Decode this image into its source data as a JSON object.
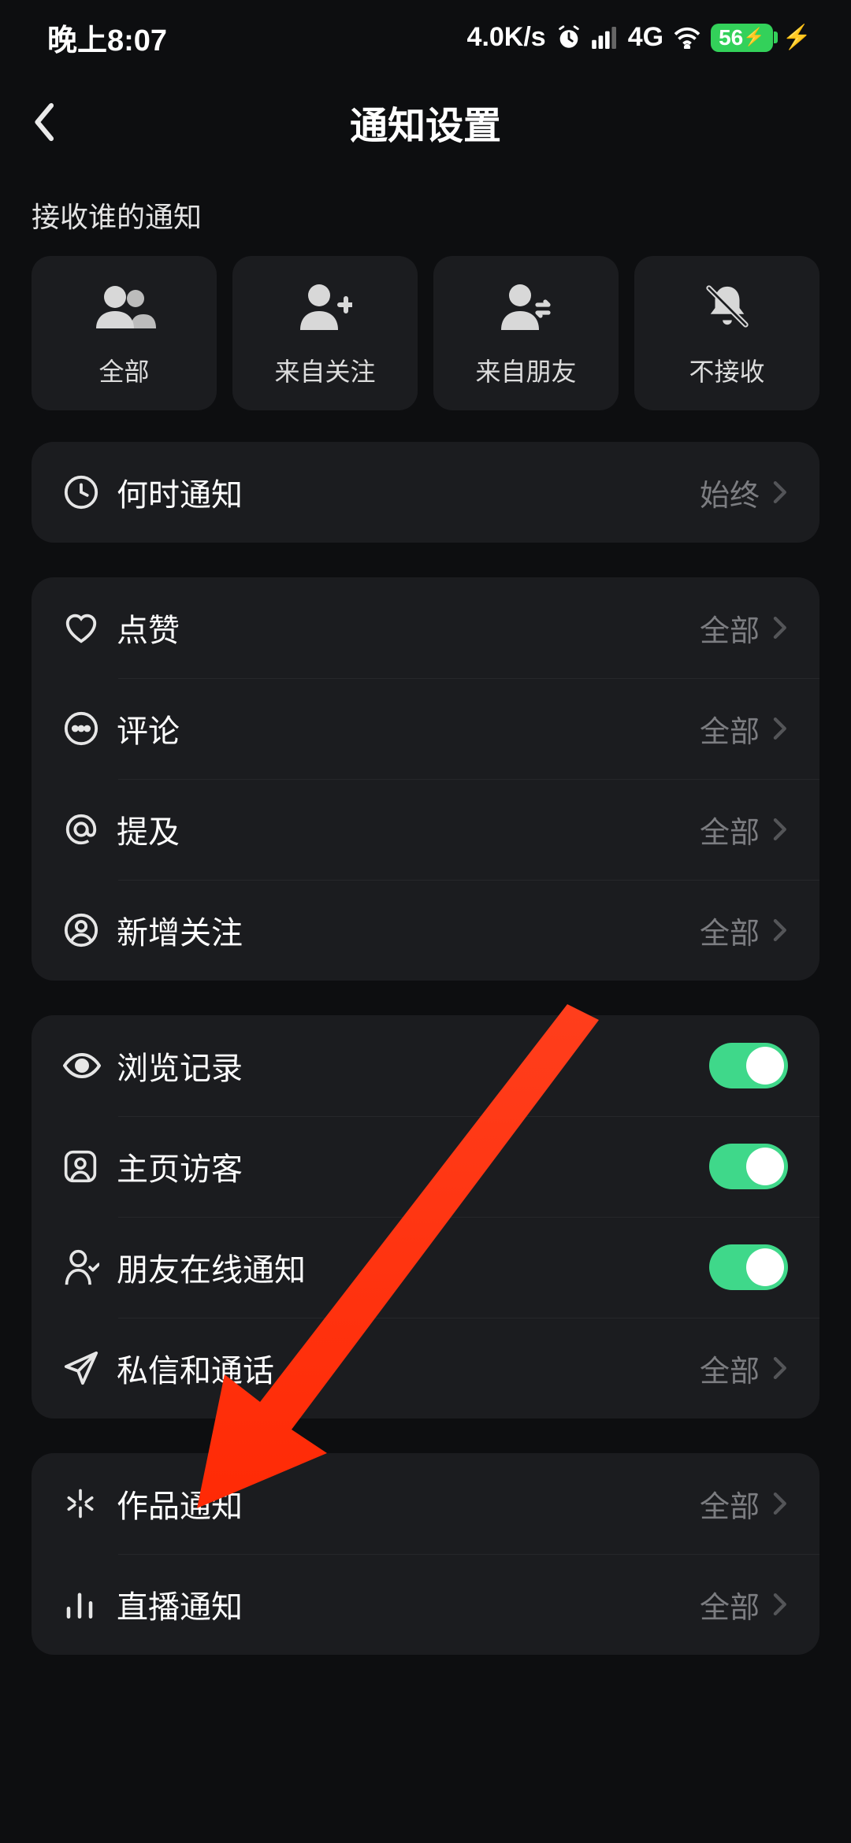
{
  "status": {
    "time": "晚上8:07",
    "net_speed": "4.0K/s",
    "signal": "4G",
    "battery": "56"
  },
  "nav": {
    "title": "通知设置"
  },
  "section_label": "接收谁的通知",
  "filters": [
    {
      "label": "全部"
    },
    {
      "label": "来自关注"
    },
    {
      "label": "来自朋友"
    },
    {
      "label": "不接收"
    }
  ],
  "group_when": {
    "when_label": "何时通知",
    "when_value": "始终"
  },
  "group_interact": {
    "like_label": "点赞",
    "like_value": "全部",
    "comment_label": "评论",
    "comment_value": "全部",
    "mention_label": "提及",
    "mention_value": "全部",
    "newfollow_label": "新增关注",
    "newfollow_value": "全部"
  },
  "group_privacy": {
    "browse_label": "浏览记录",
    "visitor_label": "主页访客",
    "online_label": "朋友在线通知",
    "dm_label": "私信和通话",
    "dm_value": "全部"
  },
  "group_content": {
    "works_label": "作品通知",
    "works_value": "全部",
    "live_label": "直播通知",
    "live_value": "全部"
  }
}
